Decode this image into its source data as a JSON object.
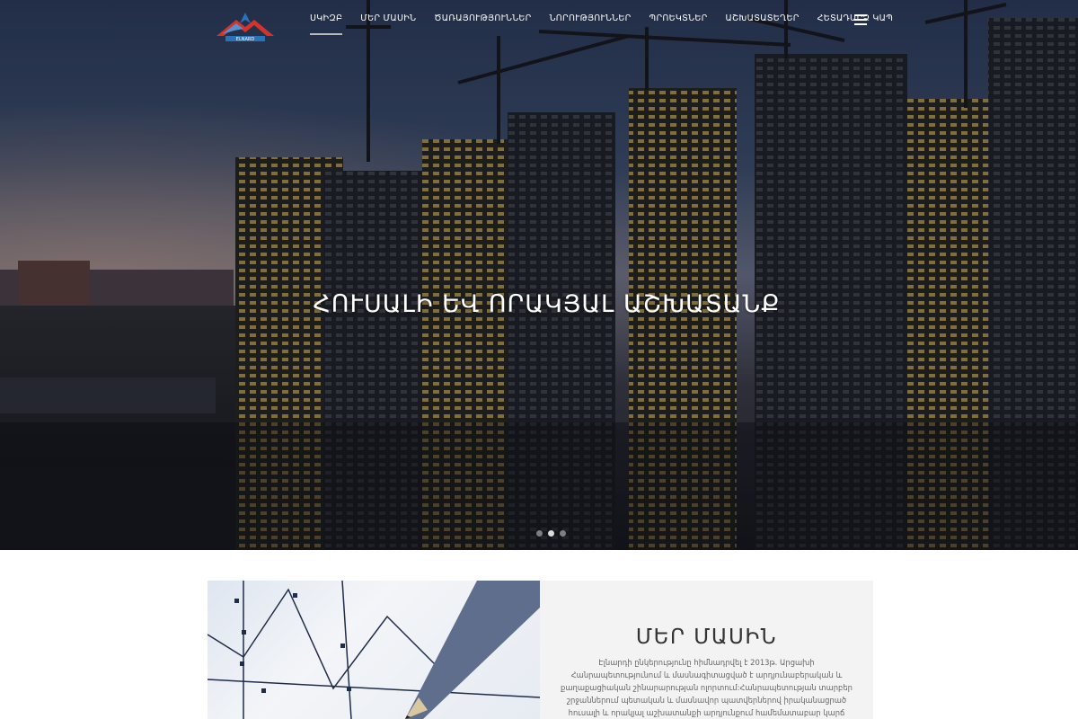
{
  "header": {
    "logo_text": "ELNARD",
    "nav": [
      {
        "label": "ՍԿԻԶԲ",
        "active": true
      },
      {
        "label": "ՄԵՐ ՄԱՍԻՆ"
      },
      {
        "label": "ԾԱՌԱՅՈՒԹՅՈՒՆՆԵՐ"
      },
      {
        "label": "ՆՈՐՈՒԹՅՈՒՆՆԵՐ"
      },
      {
        "label": "ՊՐՈԵԿՏՆԵՐ"
      },
      {
        "label": "ԱՇԽԱՏԱՏԵՂԵՐ"
      },
      {
        "label": "ՀԵՏԱԴԱՐՁ ԿԱՊ"
      }
    ],
    "menu_icon": "hamburger-icon"
  },
  "hero": {
    "title": "ՀՈՒՍԱԼԻ ԵՎ ՈՐԱԿՅԱԼ ԱՇԽԱՏԱՆՔ",
    "slides": 3,
    "active_slide": 2
  },
  "about": {
    "title": "ՄԵՐ ՄԱՍԻՆ",
    "text": "Էլնարդի ընկերությունը հիմնադրվել է 2013թ. Արցախի Հանրապետությունում և մասնագիտացված է արդյունաբերական և քաղաքացիական շինարարության ոլորտում:Հանրապետության տարբեր շրջաններում պետական և մասնավոր պատվերներով իրականացրած հուսալի և որակյալ աշխատանքի արդյունքում համեմատաբար կարճ"
  },
  "colors": {
    "nav_text": "#ffffff",
    "about_bg": "#f3f3f3",
    "about_title": "#333333",
    "logo_red": "#d0342c",
    "logo_blue": "#2b73b8"
  }
}
